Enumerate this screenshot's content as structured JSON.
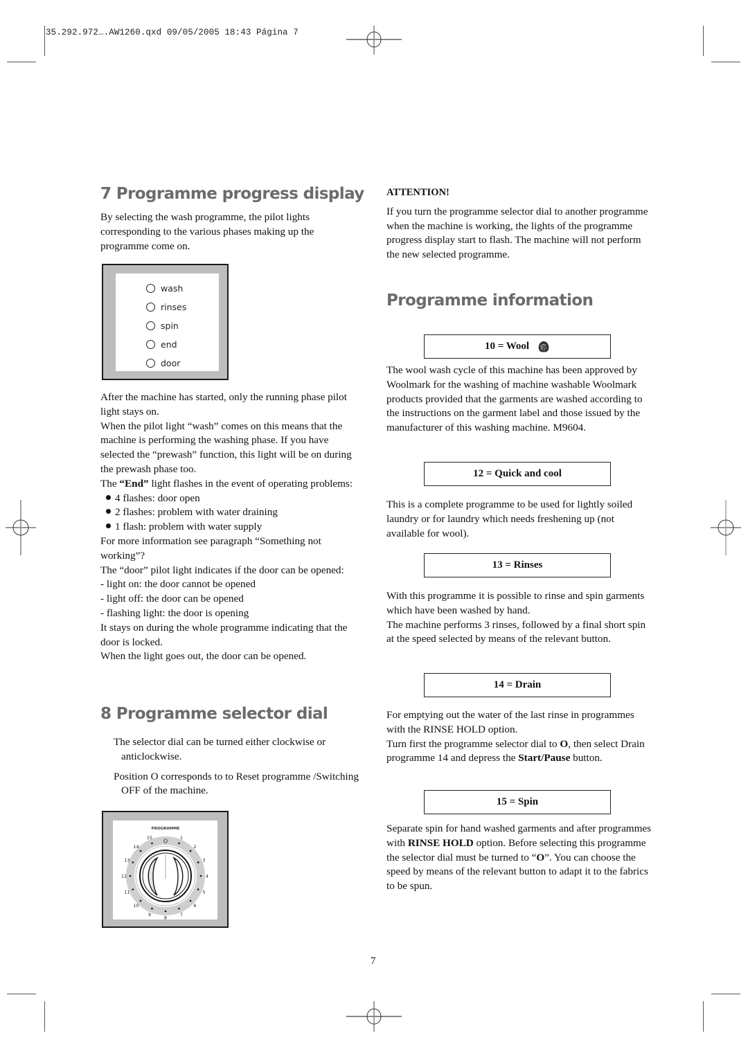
{
  "slug": {
    "text": "35.292.972….AW1260.qxd  09/05/2005  18:43  Página 7"
  },
  "section7": {
    "title": "7 Programme progress display",
    "intro": "By selecting the wash programme, the pilot lights corresponding to the various phases making up the programme come on.",
    "lights": [
      {
        "label": "wash",
        "icon": "pilot-light-circle"
      },
      {
        "label": "rinses",
        "icon": "pilot-light-circle"
      },
      {
        "label": "spin",
        "icon": "pilot-light-circle"
      },
      {
        "label": "end",
        "icon": "pilot-light-circle"
      },
      {
        "label": "door",
        "icon": "pilot-light-circle"
      }
    ],
    "para_running": "After the machine has started, only the running phase pilot light stays on.",
    "para_wash": "When the pilot light “wash” comes on this means that the machine is performing the washing phase. If you have selected the “prewash” function, this light will be on during the prewash phase too.",
    "para_end_pre": "The ",
    "para_end_bold": "“End”",
    "para_end_post": " light flashes in the event of operating problems:",
    "flashes": [
      "4 flashes: door open",
      "2 flashes: problem with water draining",
      "1 flash: problem with water supply"
    ],
    "para_more": "For more information see paragraph “Something not working”?",
    "para_door": "The “door” pilot light indicates if the door can be opened:",
    "door_states": [
      "- light on: the door cannot be opened",
      "- light off: the door can be opened",
      "- flashing light: the door is opening"
    ],
    "para_stays": "It stays on during the whole programme indicating that the door is locked.",
    "para_out": "When the light goes out, the door can be opened."
  },
  "section8": {
    "title": "8 Programme selector dial",
    "para_turn": "The selector dial can be turned either clockwise or anticlockwise.",
    "para_position": "Position O corresponds to to Reset programme /Switching OFF of the machine.",
    "dial": {
      "label": "PROGRAMME",
      "positions": [
        "O",
        "1",
        "2",
        "3",
        "4",
        "5",
        "6",
        "7",
        "8",
        "9",
        "10",
        "11",
        "12",
        "13",
        "14",
        "15"
      ]
    }
  },
  "attention": {
    "title": "ATTENTION!",
    "text": "If you turn the programme selector dial to another programme when the machine is working, the lights of the programme progress display start to flash. The machine will not perform the new selected programme."
  },
  "programme_info": {
    "title": "Programme information",
    "programmes": [
      {
        "label": "10 = Wool",
        "icon": "woolmark-icon",
        "paragraphs": [
          "The wool wash cycle of this machine has been approved by Woolmark for the washing of machine washable Woolmark products provided that the garments are washed according to the instructions on the garment label and those issued by the manufacturer of this washing machine. M9604."
        ]
      },
      {
        "label": "12 = Quick and cool",
        "paragraphs": [
          "This is a complete programme to be used for lightly soiled laundry or for laundry which needs freshening up (not available for wool)."
        ]
      },
      {
        "label": "13 = Rinses",
        "paragraphs": [
          "With this programme it is possible to rinse and spin garments which have been washed by hand.",
          "The machine performs 3 rinses, followed by a final short spin at the speed selected by means of the relevant button."
        ]
      },
      {
        "label": "14 = Drain",
        "p1": "For emptying out the water of the last rinse in programmes with the RINSE HOLD option.",
        "p2_a": "Turn first the programme selector dial to ",
        "p2_b": "O",
        "p2_c": ", then select Drain programme 14 and depress the ",
        "p2_d": "Start/Pause",
        "p2_e": " button."
      },
      {
        "label": "15 = Spin",
        "p_a": "Separate spin for hand washed garments and after programmes with ",
        "p_b": "RINSE HOLD",
        "p_c": " option. Before selecting this programme the selector dial must be turned to “",
        "p_d": "O",
        "p_e": "”. You can choose the speed by means of the relevant button to adapt it to the fabrics to be spun."
      }
    ]
  },
  "page_number": "7"
}
